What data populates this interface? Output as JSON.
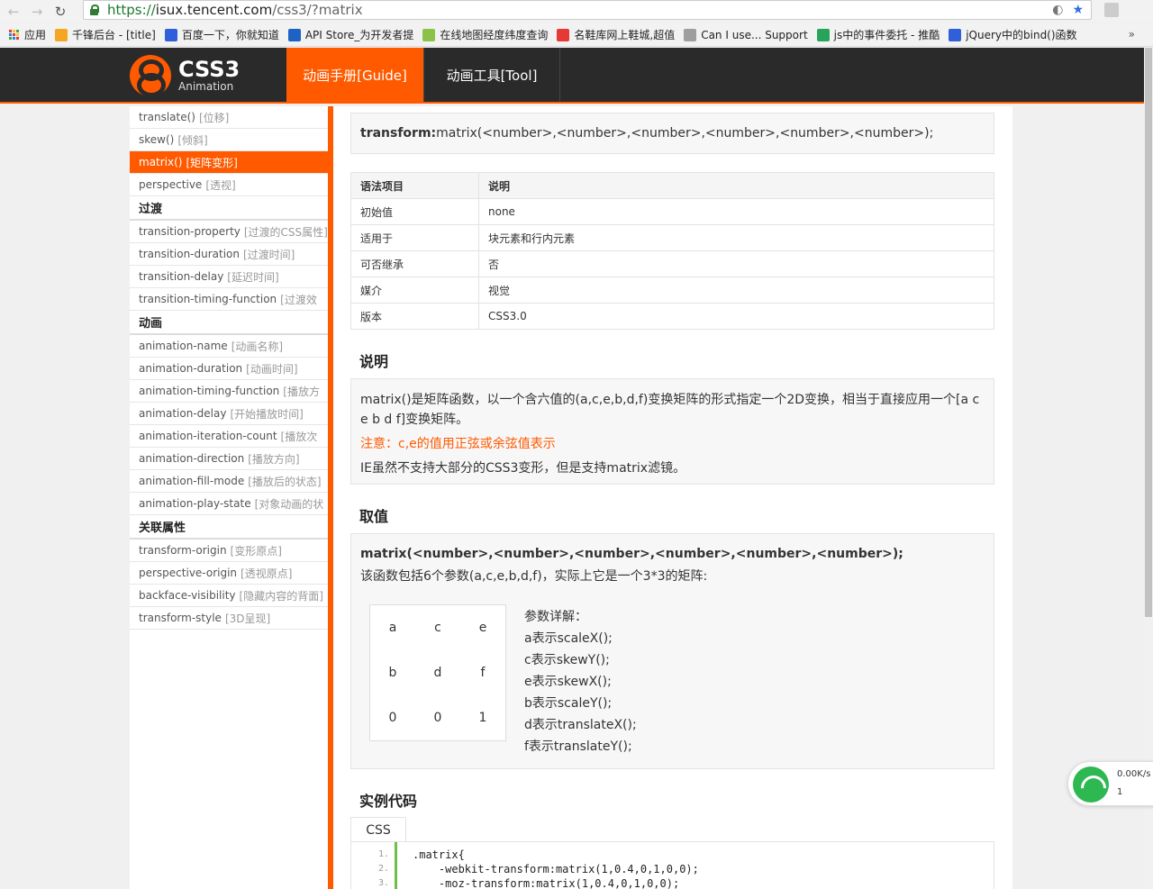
{
  "browser": {
    "url_https": "https://",
    "url_host": "isux.tencent.com",
    "url_path": "/css3/?matrix",
    "bookmarks": [
      {
        "label": "应用",
        "color": "#e53935"
      },
      {
        "label": "千锋后台 - [title]",
        "color": "#f5a623"
      },
      {
        "label": "百度一下，你就知道",
        "color": "#2f5fd9"
      },
      {
        "label": "API Store_为开发者提",
        "color": "#1e63c4"
      },
      {
        "label": "在线地图经度纬度查询",
        "color": "#8bc34a"
      },
      {
        "label": "名鞋库网上鞋城,超值",
        "color": "#e53935"
      },
      {
        "label": "Can I use... Support",
        "color": "#9e9e9e"
      },
      {
        "label": "js中的事件委托 - 推酷",
        "color": "#27a35a"
      },
      {
        "label": "jQuery中的bind()函数",
        "color": "#2f5fd9"
      }
    ],
    "more": "»"
  },
  "header": {
    "logo_title": "CSS3",
    "logo_sub": "Animation",
    "tabs": [
      {
        "label": "动画手册[Guide]",
        "active": true
      },
      {
        "label": "动画工具[Tool]",
        "active": false
      }
    ]
  },
  "sidebar": {
    "items": [
      {
        "type": "item",
        "name": "translate()",
        "hint": "[位移]"
      },
      {
        "type": "item",
        "name": "skew()",
        "hint": "[倾斜]"
      },
      {
        "type": "item",
        "name": "matrix()",
        "hint": "[矩阵变形]",
        "active": true
      },
      {
        "type": "item",
        "name": "perspective",
        "hint": "[透视]"
      },
      {
        "type": "group",
        "name": "过渡"
      },
      {
        "type": "item",
        "name": "transition-property",
        "hint": "[过渡的CSS属性]"
      },
      {
        "type": "item",
        "name": "transition-duration",
        "hint": "[过渡时间]"
      },
      {
        "type": "item",
        "name": "transition-delay",
        "hint": "[延迟时间]"
      },
      {
        "type": "item",
        "name": "transition-timing-function",
        "hint": "[过渡效"
      },
      {
        "type": "group",
        "name": "动画"
      },
      {
        "type": "item",
        "name": "animation-name",
        "hint": "[动画名称]"
      },
      {
        "type": "item",
        "name": "animation-duration",
        "hint": "[动画时间]"
      },
      {
        "type": "item",
        "name": "animation-timing-function",
        "hint": "[播放方"
      },
      {
        "type": "item",
        "name": "animation-delay",
        "hint": "[开始播放时间]"
      },
      {
        "type": "item",
        "name": "animation-iteration-count",
        "hint": "[播放次"
      },
      {
        "type": "item",
        "name": "animation-direction",
        "hint": "[播放方向]"
      },
      {
        "type": "item",
        "name": "animation-fill-mode",
        "hint": "[播放后的状态]"
      },
      {
        "type": "item",
        "name": "animation-play-state",
        "hint": "[对象动画的状"
      },
      {
        "type": "group",
        "name": "关联属性"
      },
      {
        "type": "item",
        "name": "transform-origin",
        "hint": "[变形原点]"
      },
      {
        "type": "item",
        "name": "perspective-origin",
        "hint": "[透视原点]"
      },
      {
        "type": "item",
        "name": "backface-visibility",
        "hint": "[隐藏内容的背面]"
      },
      {
        "type": "item",
        "name": "transform-style",
        "hint": "[3D呈现]"
      }
    ]
  },
  "syntax": {
    "prop": "transform:",
    "value": "matrix(<number>,<number>,<number>,<number>,<number>,<number>);"
  },
  "props_table": {
    "headers": [
      "语法项目",
      "说明"
    ],
    "rows": [
      [
        "初始值",
        "none"
      ],
      [
        "适用于",
        "块元素和行内元素"
      ],
      [
        "可否继承",
        "否"
      ],
      [
        "媒介",
        "视觉"
      ],
      [
        "版本",
        "CSS3.0"
      ]
    ]
  },
  "description": {
    "title": "说明",
    "line1": "matrix()是矩阵函数，以一个含六值的(a,c,e,b,d,f)变换矩阵的形式指定一个2D变换，相当于直接应用一个[a c e b d f]变换矩阵。",
    "note": "注意：c,e的值用正弦或余弦值表示",
    "line3": "IE虽然不支持大部分的CSS3变形，但是支持matrix滤镜。"
  },
  "values": {
    "title": "取值",
    "signature": "matrix(<number>,<number>,<number>,<number>,<number>,<number>);",
    "intro": "该函数包括6个参数(a,c,e,b,d,f)，实际上它是一个3*3的矩阵:",
    "matrix": [
      "a",
      "c",
      "e",
      "b",
      "d",
      "f",
      "0",
      "0",
      "1"
    ],
    "params_title": "参数详解：",
    "params": [
      "a表示scaleX();",
      "c表示skewY();",
      "e表示skewX();",
      "b表示scaleY();",
      "d表示translateX();",
      "f表示translateY();"
    ]
  },
  "example": {
    "title": "实例代码",
    "tab": "CSS",
    "line_numbers": [
      "1.",
      "2.",
      "3."
    ],
    "code": [
      ".matrix{",
      "    -webkit-transform:matrix(1,0.4,0,1,0,0);",
      "    -moz-transform:matrix(1,0.4,0,1,0,0);"
    ]
  },
  "widget": {
    "speed": "0.00K/s",
    "count": "1"
  }
}
